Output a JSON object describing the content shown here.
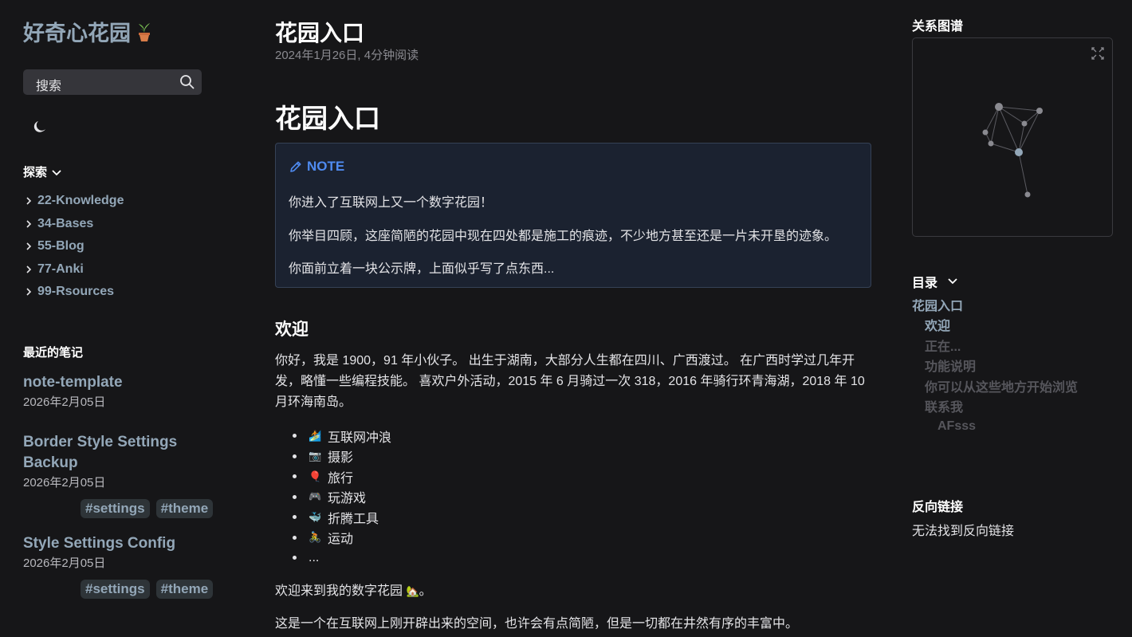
{
  "site": {
    "title": "好奇心花园",
    "search_label": "搜索"
  },
  "explorer": {
    "title": "探索",
    "items": [
      "22-Knowledge",
      "34-Bases",
      "55-Blog",
      "77-Anki",
      "99-Rsources"
    ]
  },
  "recent": {
    "title": "最近的笔记",
    "notes": [
      {
        "title": "note-template",
        "date": "2026年2月05日",
        "tags": []
      },
      {
        "title_line1": "Border Style Settings",
        "title_line2": "Backup",
        "date": "2026年2月05日",
        "tags": [
          "#settings",
          "#theme"
        ]
      },
      {
        "title": "Style Settings Config",
        "date": "2026年2月05日",
        "tags": [
          "#settings",
          "#theme"
        ]
      }
    ]
  },
  "page": {
    "title": "花园入口",
    "meta": "2024年1月26日, 4分钟阅读",
    "h1": "花园入口",
    "callout": {
      "type": "NOTE",
      "lines": [
        "你进入了互联网上又一个数字花园！",
        "你举目四顾，这座简陋的花园中现在四处都是施工的痕迹，不少地方甚至还是一片未开垦的迹象。",
        "你面前立着一块公示牌，上面似乎写了点东西..."
      ]
    },
    "h2": "欢迎",
    "intro_lines": [
      "你好，我是 1900，91 年小伙子。 出生于湖南，大部分人生都在四川、广西渡过。 在广西时学过几年开",
      "发，略懂一些编程技能。 喜欢户外活动，2015 年 6 月骑过一次 318，2016 年骑行环青海湖，2018 年 10",
      "月环海南岛。"
    ],
    "hobbies": [
      {
        "emoji": "🏄",
        "text": "互联网冲浪"
      },
      {
        "emoji": "📷",
        "text": "摄影"
      },
      {
        "emoji": "🎈",
        "text": "旅行"
      },
      {
        "emoji": "🎮",
        "text": "玩游戏"
      },
      {
        "emoji": "🐳",
        "text": "折腾工具"
      },
      {
        "emoji": "🚴",
        "text": "运动"
      },
      {
        "emoji": "",
        "text": "..."
      }
    ],
    "welcome_prefix": "欢迎来到我的数字花园",
    "welcome_emoji": "🏡",
    "welcome_suffix": "。",
    "closing": "这是一个在互联网上刚开辟出来的空间，也许会有点简陋，但是一切都在井然有序的丰富中。"
  },
  "graph": {
    "title": "关系图谱"
  },
  "toc": {
    "title": "目录",
    "items": [
      {
        "label": "花园入口",
        "level": 0,
        "active": true
      },
      {
        "label": "欢迎",
        "level": 1,
        "active": true
      },
      {
        "label": "正在...",
        "level": 1,
        "active": false
      },
      {
        "label": "功能说明",
        "level": 1,
        "active": false
      },
      {
        "label": "你可以从这些地方开始浏览",
        "level": 1,
        "active": false
      },
      {
        "label": "联系我",
        "level": 1,
        "active": false
      },
      {
        "label": "AFsss",
        "level": 2,
        "active": false
      }
    ]
  },
  "backlinks": {
    "title": "反向链接",
    "empty": "无法找到反向链接"
  },
  "colors": {
    "background": "#161618",
    "accent": "#93a7b8",
    "note_blue": "#4f8bf0",
    "callout_bg": "#1b2230"
  }
}
